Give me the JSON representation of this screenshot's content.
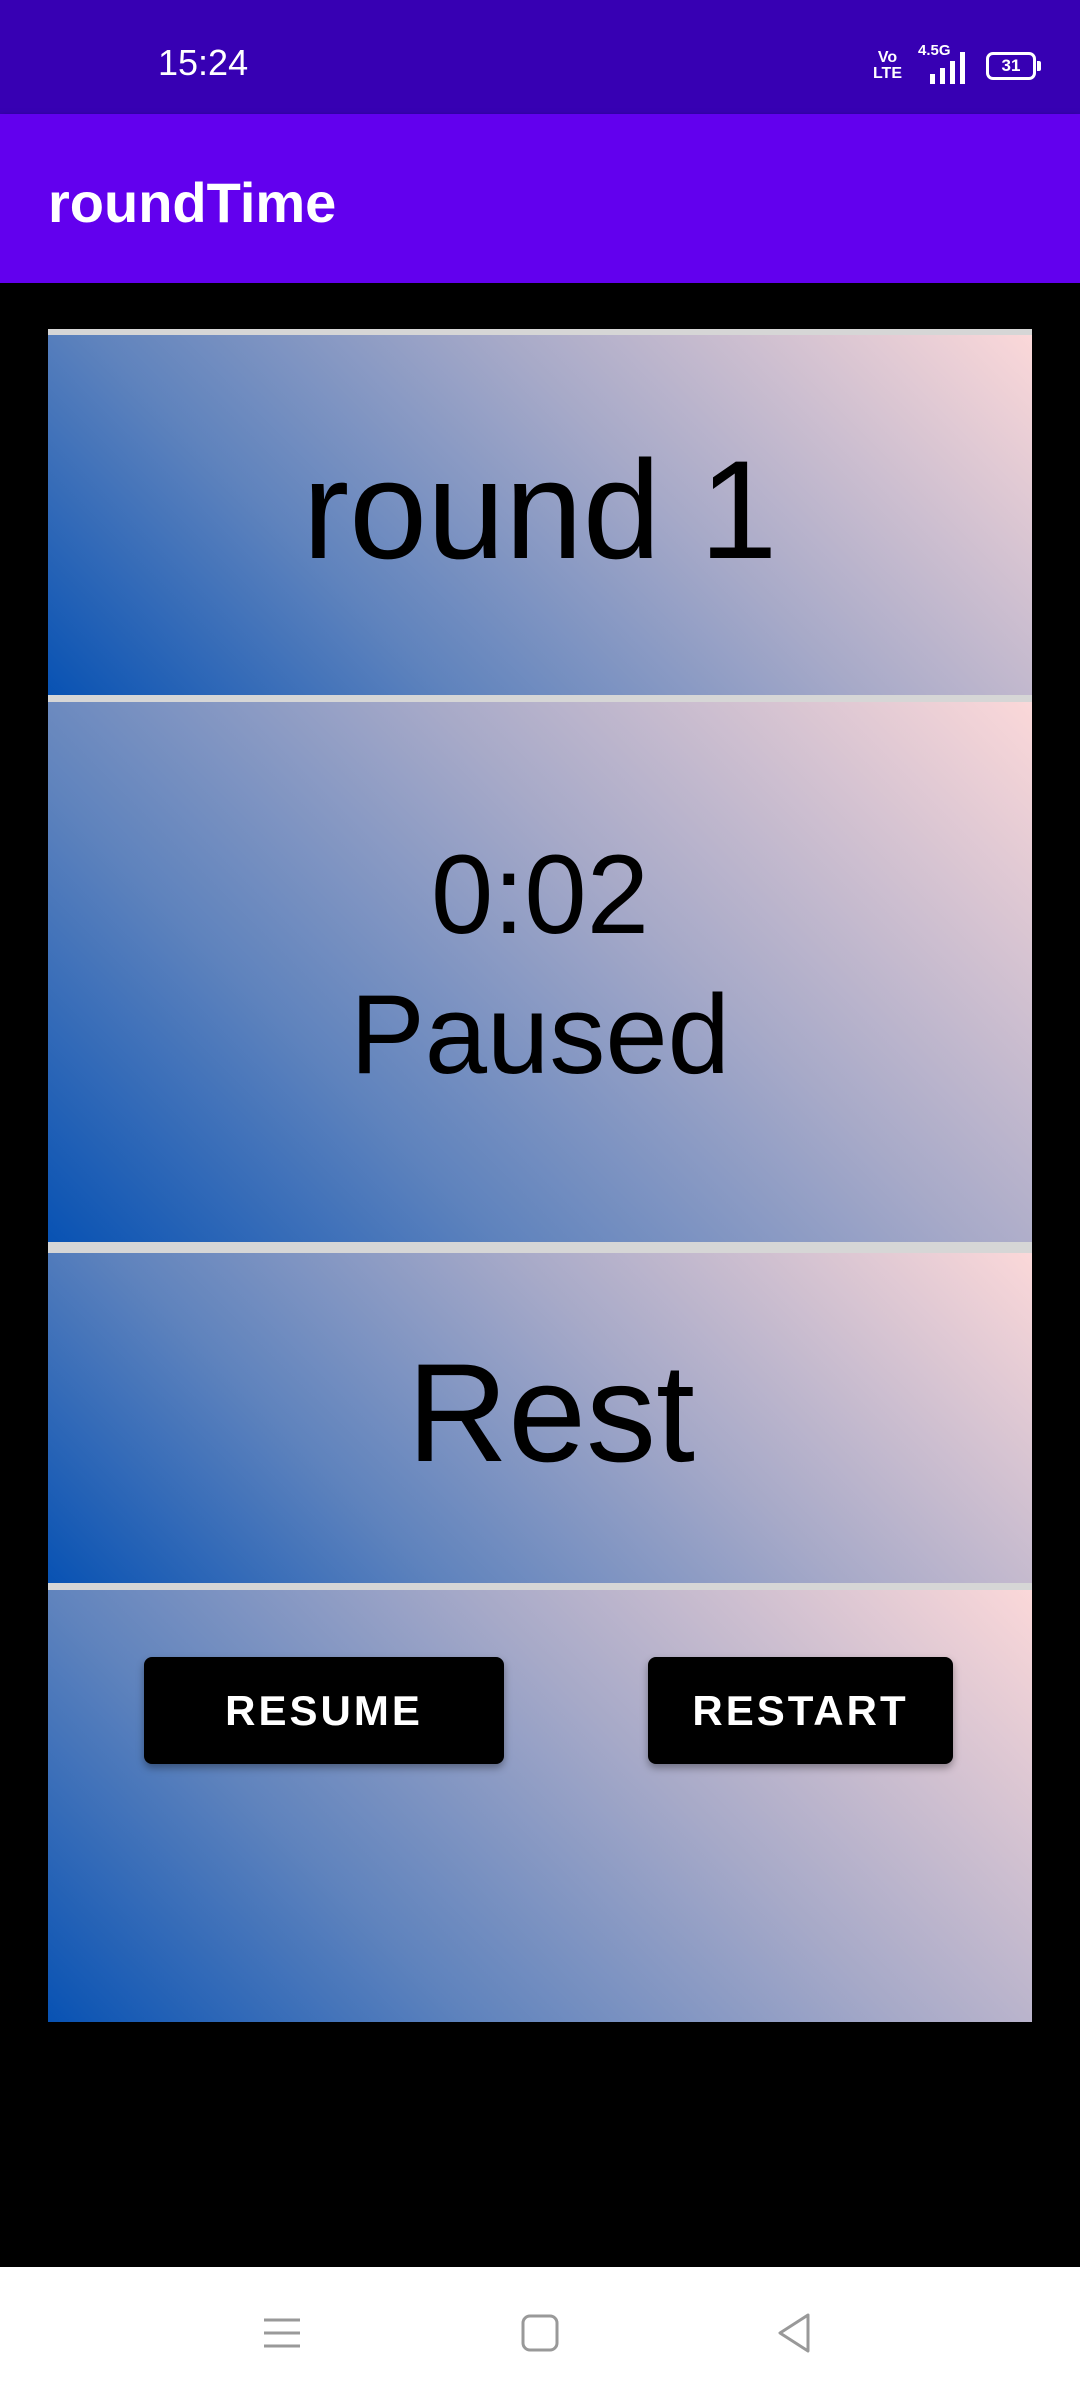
{
  "status_bar": {
    "time": "15:24",
    "volte_top": "Vo",
    "volte_bottom": "LTE",
    "network": "4.5G",
    "battery": "31"
  },
  "app_bar": {
    "title": "roundTime"
  },
  "round_panel": {
    "label": "round 1"
  },
  "timer_panel": {
    "time": "0:02",
    "state": "Paused"
  },
  "phase_panel": {
    "label": "Rest"
  },
  "buttons": {
    "resume_label": "RESUME",
    "restart_label": "RESTART"
  },
  "nav_bar": {
    "icons": [
      "menu-icon",
      "home-icon",
      "back-icon"
    ]
  },
  "colors": {
    "status_bar": "#3700B3",
    "app_bar": "#6200EE",
    "gradient_start": "#0852b3",
    "gradient_end": "#fbd8d9"
  }
}
